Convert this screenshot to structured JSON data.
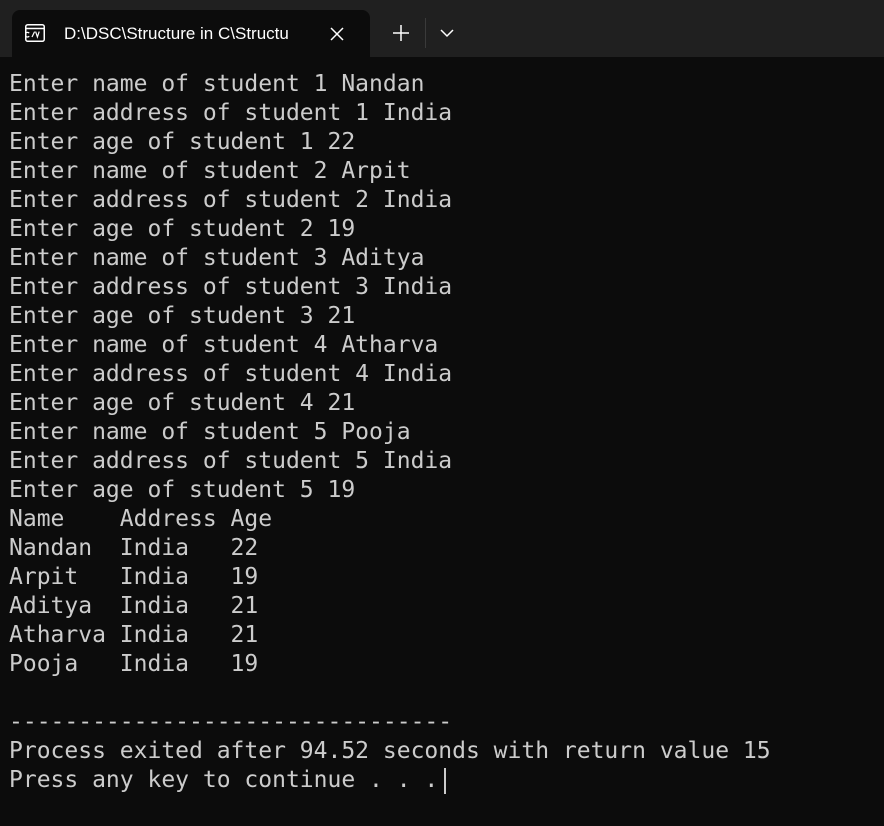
{
  "tab": {
    "title": "D:\\DSC\\Structure in C\\Structu",
    "icon": "console-icon"
  },
  "terminal": {
    "lines": [
      "Enter name of student 1 Nandan",
      "Enter address of student 1 India",
      "Enter age of student 1 22",
      "Enter name of student 2 Arpit",
      "Enter address of student 2 India",
      "Enter age of student 2 19",
      "Enter name of student 3 Aditya",
      "Enter address of student 3 India",
      "Enter age of student 3 21",
      "Enter name of student 4 Atharva",
      "Enter address of student 4 India",
      "Enter age of student 4 21",
      "Enter name of student 5 Pooja",
      "Enter address of student 5 India",
      "Enter age of student 5 19",
      "Name    Address Age",
      "Nandan  India   22",
      "Arpit   India   19",
      "Aditya  India   21",
      "Atharva India   21",
      "Pooja   India   19",
      "",
      "--------------------------------",
      "Process exited after 94.52 seconds with return value 15",
      "Press any key to continue . . ."
    ]
  },
  "colors": {
    "background": "#0c0c0c",
    "titlebar": "#202020",
    "text": "#cccccc"
  }
}
